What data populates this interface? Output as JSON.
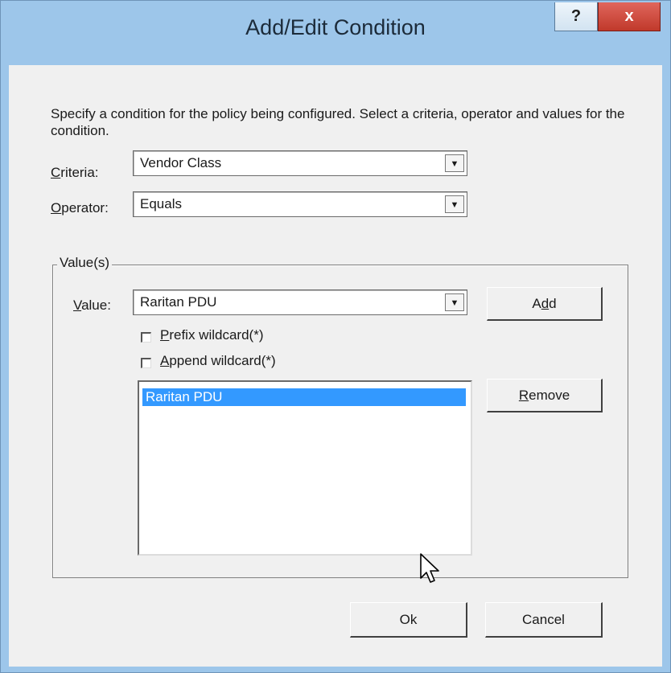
{
  "window": {
    "title": "Add/Edit Condition",
    "help_label": "?",
    "close_label": "x"
  },
  "description": "Specify a condition for the policy being configured. Select a criteria, operator and values for the condition.",
  "criteria": {
    "label_accel": "C",
    "label_rest": "riteria:",
    "value": "Vendor Class"
  },
  "operator": {
    "label_accel": "O",
    "label_rest": "perator:",
    "value": "Equals"
  },
  "values_group": {
    "title": "Value(s)",
    "value_label_accel": "V",
    "value_label_rest": "alue:",
    "value": "Raritan PDU",
    "prefix_accel": "P",
    "prefix_rest": "refix wildcard(*)",
    "prefix_checked": false,
    "append_accel": "A",
    "append_rest": "ppend wildcard(*)",
    "append_checked": false,
    "list": [
      "Raritan PDU"
    ],
    "add_pre": "A",
    "add_accel": "d",
    "add_post": "d",
    "remove_accel": "R",
    "remove_rest": "emove"
  },
  "buttons": {
    "ok": "Ok",
    "cancel": "Cancel"
  },
  "colors": {
    "frame": "#9dc6ea",
    "selection": "#3399ff",
    "close": "#c0392b"
  }
}
